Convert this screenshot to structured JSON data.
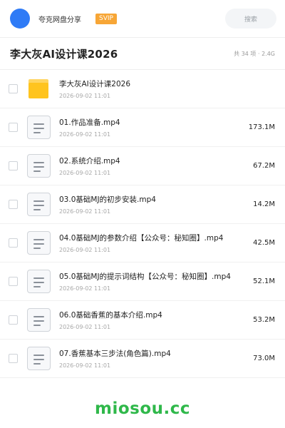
{
  "header": {
    "app_name": "夸克网盘分享",
    "vip_badge": "SVIP",
    "search_placeholder": "搜索",
    "avatar_color": "#2f7bf6",
    "vip_color": "#f7a636"
  },
  "folder": {
    "title": "李大灰AI设计课2026",
    "meta": "共 34 项 · 2.4G"
  },
  "files": [
    {
      "name": "李大灰AI设计课2026",
      "date": "2026-09-02 11:01",
      "size": "",
      "type": "folder",
      "icon": "folder-icon"
    },
    {
      "name": "01.作品准备.mp4",
      "date": "2026-09-02 11:01",
      "size": "173.1M",
      "type": "file",
      "icon": "document-icon"
    },
    {
      "name": "02.系统介绍.mp4",
      "date": "2026-09-02 11:01",
      "size": "67.2M",
      "type": "file",
      "icon": "document-icon"
    },
    {
      "name": "03.0基础MJ的初步安装.mp4",
      "date": "2026-09-02 11:01",
      "size": "14.2M",
      "type": "file",
      "icon": "document-icon"
    },
    {
      "name": "04.0基础MJ的参数介绍【公众号：秘知圈】.mp4",
      "date": "2026-09-02 11:01",
      "size": "42.5M",
      "type": "file",
      "icon": "document-icon"
    },
    {
      "name": "05.0基础MJ的提示词结构【公众号：秘知圈】.mp4",
      "date": "2026-09-02 11:01",
      "size": "52.1M",
      "type": "file",
      "icon": "document-icon"
    },
    {
      "name": "06.0基础香蕉的基本介绍.mp4",
      "date": "2026-09-02 11:01",
      "size": "53.2M",
      "type": "file",
      "icon": "document-icon"
    },
    {
      "name": "07.香蕉基本三步法(角色篇).mp4",
      "date": "2026-09-02 11:01",
      "size": "73.0M",
      "type": "file",
      "icon": "document-icon"
    }
  ],
  "watermark": "miosou.cc",
  "watermark_color": "#2fb84a"
}
